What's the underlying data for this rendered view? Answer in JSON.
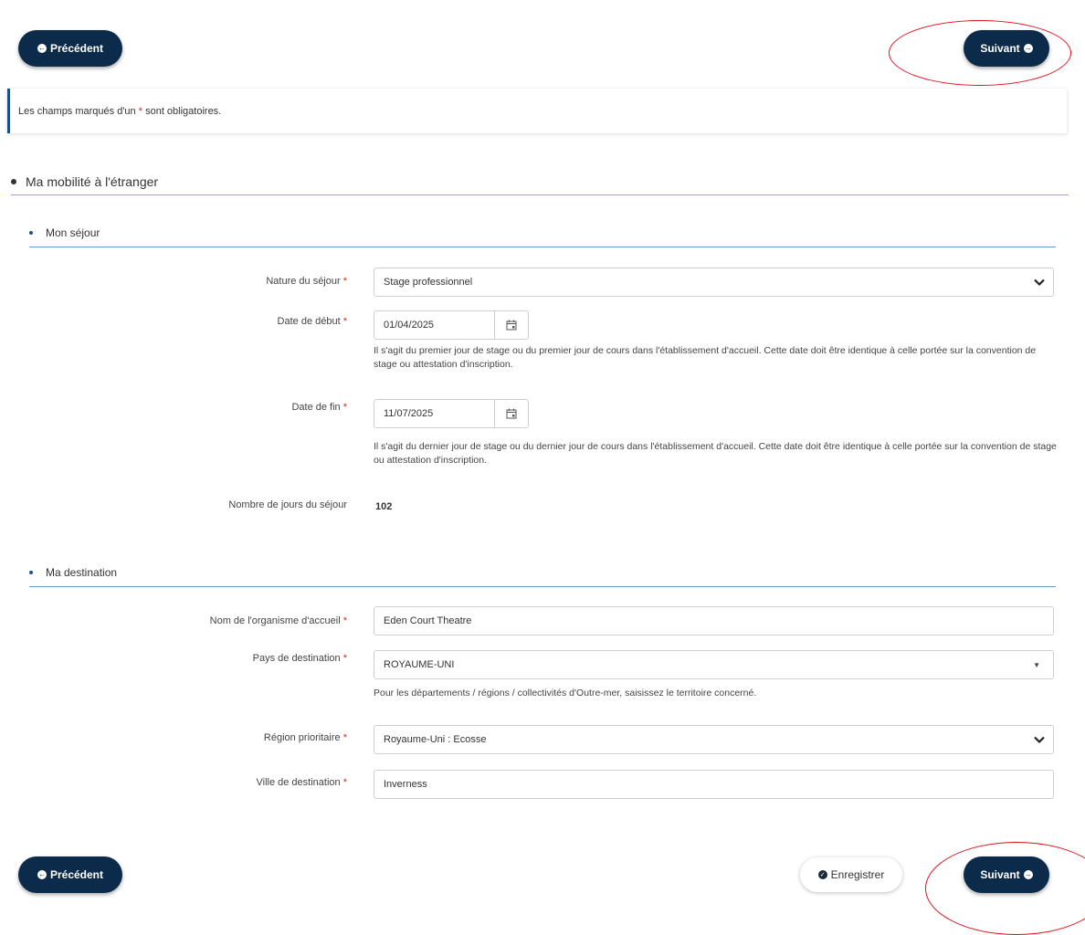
{
  "nav": {
    "prev_label": "Précédent",
    "next_label": "Suivant",
    "save_label": "Enregistrer"
  },
  "info": {
    "prefix": "Les champs marqués d'un",
    "asterisk": "*",
    "suffix": "sont obligatoires."
  },
  "section": {
    "title": "Ma mobilité à l'étranger"
  },
  "sejour": {
    "title": "Mon séjour",
    "nature_label": "Nature du séjour",
    "nature_value": "Stage professionnel",
    "debut_label": "Date de début",
    "debut_value": "01/04/2025",
    "debut_help": "Il s'agit du premier jour de stage ou du premier jour de cours dans l'établissement d'accueil. Cette date doit être identique à celle portée sur la convention de stage ou attestation d'inscription.",
    "fin_label": "Date de fin",
    "fin_value": "11/07/2025",
    "fin_help": "Il s'agit du dernier jour de stage ou du dernier jour de cours dans l'établissement d'accueil. Cette date doit être identique à celle portée sur la convention de stage ou attestation d'inscription.",
    "jours_label": "Nombre de jours du séjour",
    "jours_value": "102"
  },
  "destination": {
    "title": "Ma destination",
    "organisme_label": "Nom de l'organisme d'accueil",
    "organisme_value": "Eden Court Theatre",
    "pays_label": "Pays de destination",
    "pays_value": "ROYAUME-UNI",
    "pays_help": "Pour les départements / régions / collectivités d'Outre-mer, saisissez le territoire concerné.",
    "region_label": "Région prioritaire",
    "region_value": "Royaume-Uni : Ecosse",
    "ville_label": "Ville de destination",
    "ville_value": "Inverness"
  },
  "required_mark": "*",
  "colors": {
    "primary_button": "#0c2a4a",
    "required": "#d9261c",
    "section_rule": "#f29a3c",
    "subsection_rule": "#6c97c5",
    "annotation_ellipse": "#e0101a"
  }
}
